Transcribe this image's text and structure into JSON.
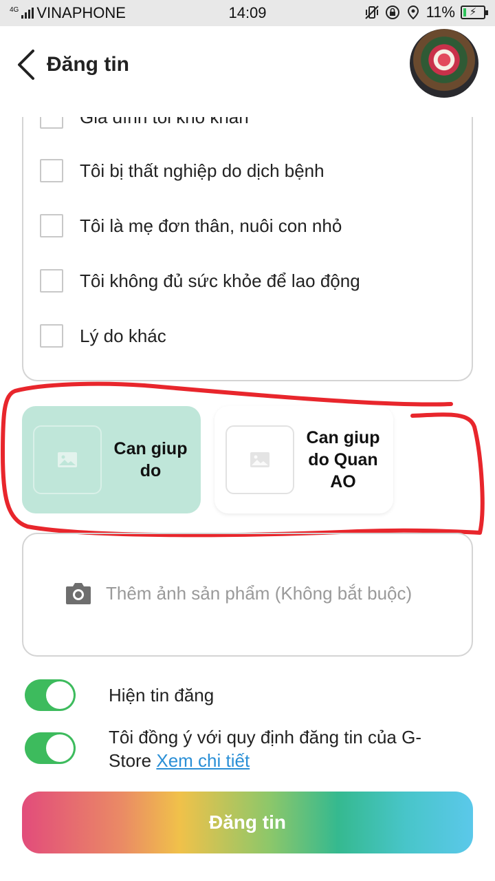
{
  "status_bar": {
    "network_type": "4G",
    "carrier": "VINAPHONE",
    "time": "14:09",
    "battery": "11%"
  },
  "header": {
    "title": "Đăng tin"
  },
  "reasons": [
    {
      "label": "Gia đình tôi khó khăn",
      "checked": false
    },
    {
      "label": "Tôi bị thất nghiệp do dịch bệnh",
      "checked": false
    },
    {
      "label": "Tôi là mẹ đơn thân, nuôi con nhỏ",
      "checked": false
    },
    {
      "label": "Tôi không đủ sức khỏe để lao động",
      "checked": false
    },
    {
      "label": "Lý do khác",
      "checked": false
    }
  ],
  "categories": [
    {
      "name": "Can giup do",
      "selected": true
    },
    {
      "name": "Can giup do Quan AO",
      "selected": false
    }
  ],
  "photo": {
    "placeholder": "Thêm ảnh sản phẩm (Không bắt buộc)"
  },
  "toggles": {
    "show_post": {
      "label": "Hiện tin đăng",
      "on": true
    },
    "agree": {
      "label": "Tôi đồng ý với quy định đăng tin của G-Store ",
      "link": "Xem chi tiết",
      "on": true
    }
  },
  "submit_label": "Đăng tin",
  "colors": {
    "toggle_on": "#3dbb5d",
    "selected_card": "#bfe6d9",
    "link": "#2a8fd6",
    "annotation": "#e8262c"
  }
}
